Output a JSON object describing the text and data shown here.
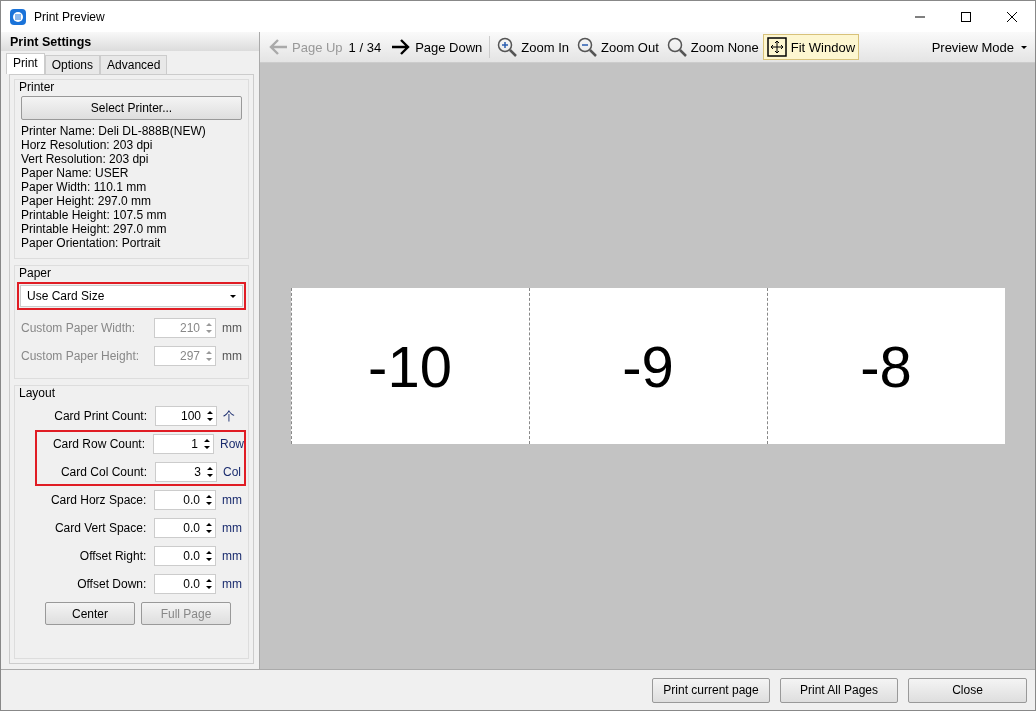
{
  "window": {
    "title": "Print Preview"
  },
  "sidebar": {
    "title": "Print Settings",
    "tabs": [
      {
        "label": "Print",
        "selected": true
      },
      {
        "label": "Options",
        "selected": false
      },
      {
        "label": "Advanced",
        "selected": false
      }
    ],
    "printer": {
      "title": "Printer",
      "button": "Select Printer...",
      "info": [
        "Printer Name: Deli DL-888B(NEW)",
        "Horz Resolution: 203 dpi",
        "Vert Resolution: 203 dpi",
        "Paper Name: USER",
        "Paper Width: 110.1 mm",
        "Paper Height: 297.0 mm",
        "Printable Height: 107.5 mm",
        "Printable Height: 297.0 mm",
        "Paper Orientation: Portrait"
      ]
    },
    "paper": {
      "title": "Paper",
      "select": {
        "value": "Use Card Size",
        "highlighted": true
      },
      "fields": [
        {
          "label": "Custom Paper Width:",
          "value": "210",
          "unit": "mm",
          "disabled": true
        },
        {
          "label": "Custom Paper Height:",
          "value": "297",
          "unit": "mm",
          "disabled": true
        }
      ]
    },
    "layout": {
      "title": "Layout",
      "fields": [
        {
          "label": "Card Print Count:",
          "value": "100",
          "unit": "个",
          "highlighted": false
        },
        {
          "label": "Card Row Count:",
          "value": "1",
          "unit": "Row",
          "highlighted": true
        },
        {
          "label": "Card Col Count:",
          "value": "3",
          "unit": "Col",
          "highlighted": true
        },
        {
          "label": "Card Horz Space:",
          "value": "0.0",
          "unit": "mm",
          "highlighted": false
        },
        {
          "label": "Card Vert Space:",
          "value": "0.0",
          "unit": "mm",
          "highlighted": false
        },
        {
          "label": "Offset Right:",
          "value": "0.0",
          "unit": "mm",
          "highlighted": false
        },
        {
          "label": "Offset Down:",
          "value": "0.0",
          "unit": "mm",
          "highlighted": false
        }
      ],
      "buttons": [
        {
          "label": "Center",
          "disabled": false
        },
        {
          "label": "Full Page",
          "disabled": true
        }
      ]
    }
  },
  "toolbar": {
    "items": [
      {
        "kind": "page-up",
        "label": "Page Up",
        "disabled": true,
        "selected": false
      },
      {
        "kind": "page-indicator",
        "label": "1 / 34"
      },
      {
        "kind": "page-down",
        "label": "Page Down",
        "disabled": false,
        "selected": false
      },
      {
        "kind": "zoom-in",
        "label": "Zoom In",
        "disabled": false,
        "selected": false
      },
      {
        "kind": "zoom-out",
        "label": "Zoom Out",
        "disabled": false,
        "selected": false
      },
      {
        "kind": "zoom-none",
        "label": "Zoom None",
        "disabled": false,
        "selected": false
      },
      {
        "kind": "fit-window",
        "label": "Fit Window",
        "disabled": false,
        "selected": true
      }
    ],
    "mode": "Preview Mode"
  },
  "preview": {
    "cards": [
      "-10",
      "-9",
      "-8"
    ]
  },
  "footer": {
    "buttons": [
      "Print current page",
      "Print All Pages",
      "Close"
    ]
  }
}
